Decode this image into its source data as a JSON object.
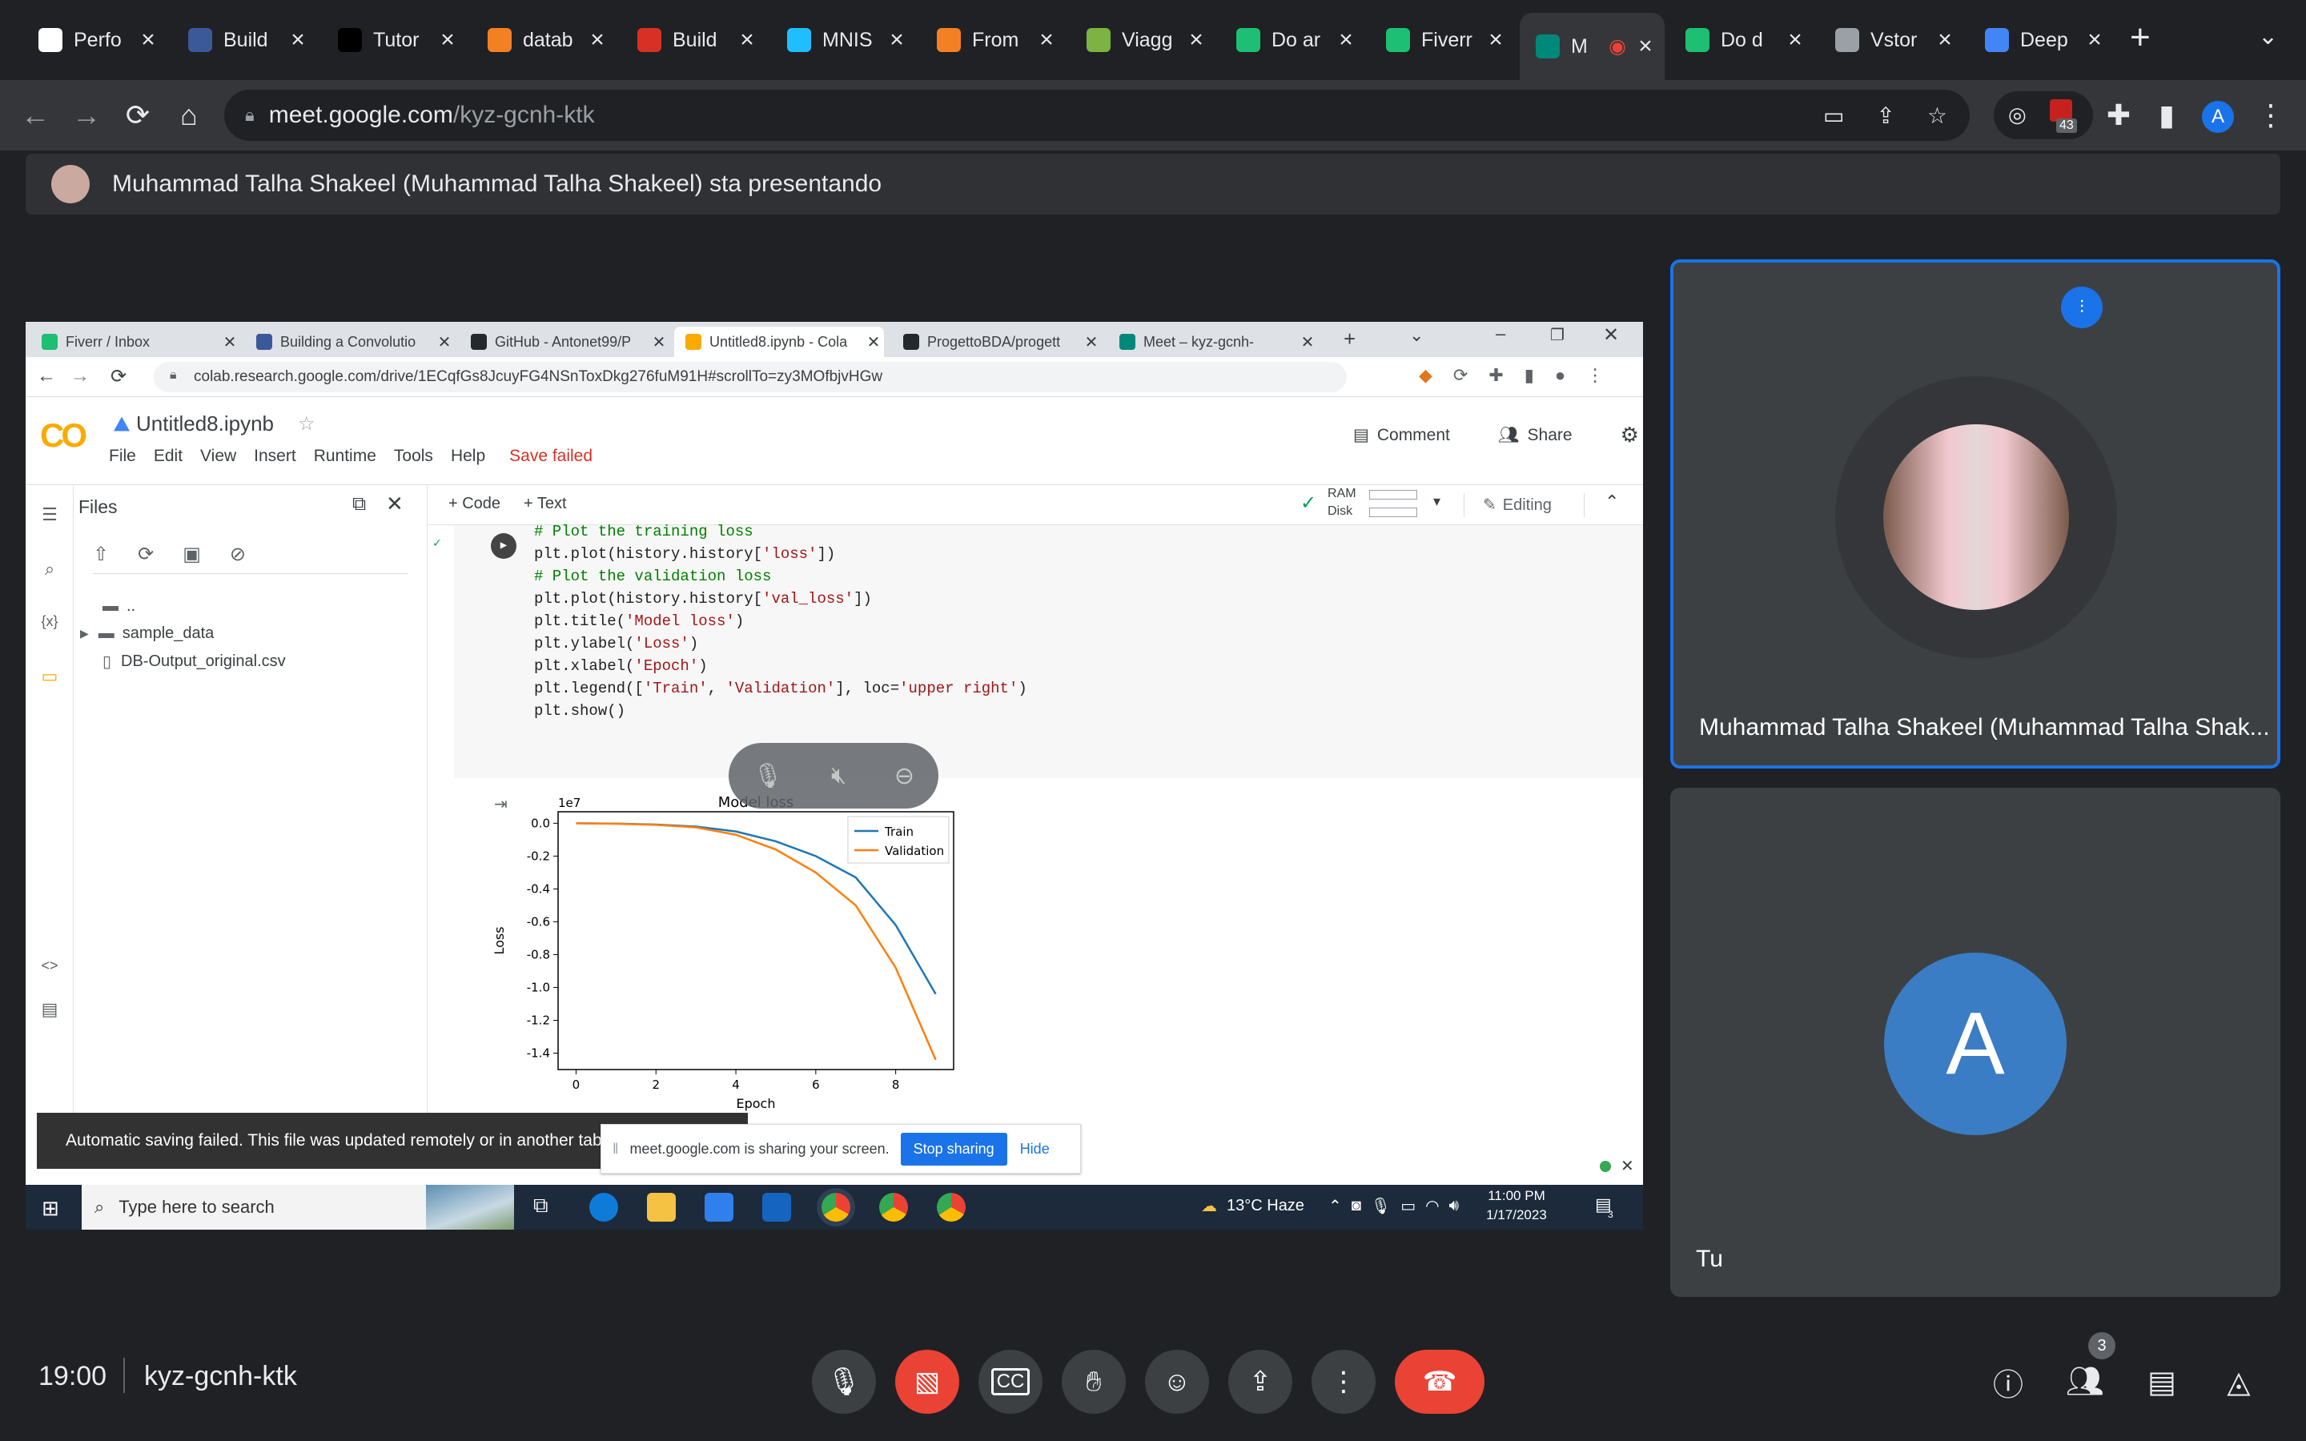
{
  "browser": {
    "tabs": [
      {
        "label": "Perfo",
        "icon": "chart-favicon",
        "color": "#ffffff"
      },
      {
        "label": "Build",
        "icon": "tds-favicon",
        "color": "#3b5998"
      },
      {
        "label": "Tutor",
        "icon": "medium-favicon",
        "color": "#000000"
      },
      {
        "label": "datab",
        "icon": "stackoverflow-favicon",
        "color": "#f48024"
      },
      {
        "label": "Build",
        "icon": "k-favicon",
        "color": "#d93025"
      },
      {
        "label": "MNIS",
        "icon": "kaggle-favicon",
        "color": "#20beff"
      },
      {
        "label": "From",
        "icon": "stackoverflow-favicon",
        "color": "#f48024"
      },
      {
        "label": "Viagg",
        "icon": "peace-favicon",
        "color": "#7cb342"
      },
      {
        "label": "Do ar",
        "icon": "fiverr-favicon",
        "color": "#1dbf73"
      },
      {
        "label": "Fiverr",
        "icon": "fiverr-favicon",
        "color": "#1dbf73"
      },
      {
        "label": "M",
        "icon": "meet-favicon",
        "color": "#00897b"
      },
      {
        "label": "Do d",
        "icon": "fiverr-favicon",
        "color": "#1dbf73"
      },
      {
        "label": "Vstor",
        "icon": "globe-favicon",
        "color": "#9aa0a6"
      },
      {
        "label": "Deep",
        "icon": "shield-favicon",
        "color": "#4285f4"
      }
    ],
    "new_tab": "+",
    "url_host": "meet.google.com",
    "url_path": "/kyz-gcnh-ktk",
    "ext_badge": "43",
    "profile_letter": "A"
  },
  "presenter_banner": "Muhammad Talha Shakeel (Muhammad Talha Shakeel) sta presentando",
  "shared": {
    "tabs": [
      {
        "label": "Fiverr / Inbox",
        "color": "#1dbf73"
      },
      {
        "label": "Building a Convolutio",
        "color": "#3b5998"
      },
      {
        "label": "GitHub - Antonet99/P",
        "color": "#24292e"
      },
      {
        "label": "Untitled8.ipynb - Cola",
        "color": "#f9ab00"
      },
      {
        "label": "ProgettoBDA/progett",
        "color": "#24292e"
      },
      {
        "label": "Meet – kyz-gcnh-",
        "color": "#00897b"
      }
    ],
    "url": "colab.research.google.com/drive/1ECqfGs8JcuyFG4NSnToxDkg276fuM91H#scrollTo=zy3MOfbjvHGw",
    "notebook_title": "Untitled8.ipynb",
    "menu": [
      "File",
      "Edit",
      "View",
      "Insert",
      "Runtime",
      "Tools",
      "Help"
    ],
    "save_status": "Save failed",
    "comment": "Comment",
    "share": "Share",
    "add_code": "+ Code",
    "add_text": "+ Text",
    "ram": "RAM",
    "disk": "Disk",
    "editing": "Editing",
    "files_title": "Files",
    "file_tree": [
      "..",
      "sample_data",
      "DB-Output_original.csv"
    ],
    "code_lines": [
      {
        "text": "# Plot the training loss",
        "kind": "com"
      },
      {
        "text": "plt.plot(history.history['loss'])",
        "kind": "code"
      },
      {
        "text": "# Plot the validation loss",
        "kind": "com"
      },
      {
        "text": "plt.plot(history.history['val_loss'])",
        "kind": "code"
      },
      {
        "text": "plt.title('Model loss')",
        "kind": "code"
      },
      {
        "text": "plt.ylabel('Loss')",
        "kind": "code"
      },
      {
        "text": "plt.xlabel('Epoch')",
        "kind": "code"
      },
      {
        "text": "plt.legend(['Train', 'Validation'], loc='upper right')",
        "kind": "code"
      },
      {
        "text": "plt.show()",
        "kind": "code"
      }
    ],
    "snackbar": "Automatic saving failed. This file was updated remotely or in another tab",
    "share_notice": "meet.google.com is sharing your screen.",
    "stop_sharing": "Stop sharing",
    "hide": "Hide",
    "taskbar_search": "Type here to search",
    "weather": "13°C  Haze",
    "time": "11:00 PM",
    "date": "1/17/2023",
    "notif_count": "3"
  },
  "chart_data": {
    "type": "line",
    "title": "Model loss",
    "xlabel": "Epoch",
    "ylabel": "Loss",
    "offset_label": "1e7",
    "x": [
      0,
      1,
      2,
      3,
      4,
      5,
      6,
      7,
      8,
      9
    ],
    "xlim": [
      -0.45,
      9.45
    ],
    "ylim": [
      -1.5,
      0.07
    ],
    "xticks": [
      "0",
      "2",
      "4",
      "6",
      "8"
    ],
    "yticks": [
      "0.0",
      "-0.2",
      "-0.4",
      "-0.6",
      "-0.8",
      "-1.0",
      "-1.2",
      "-1.4"
    ],
    "legend_position": "upper right",
    "series": [
      {
        "name": "Train",
        "color": "#1f77b4",
        "values": [
          0,
          -0.002,
          -0.008,
          -0.02,
          -0.05,
          -0.11,
          -0.2,
          -0.33,
          -0.62,
          -1.04
        ]
      },
      {
        "name": "Validation",
        "color": "#ff7f0e",
        "values": [
          0,
          -0.003,
          -0.01,
          -0.025,
          -0.07,
          -0.16,
          -0.3,
          -0.5,
          -0.88,
          -1.44
        ]
      }
    ]
  },
  "tiles": {
    "speaker_name": "Muhammad Talha Shakeel (Muhammad Talha Shak...",
    "self_name": "Tu",
    "self_initial": "A"
  },
  "meeting": {
    "time": "19:00",
    "code": "kyz-gcnh-ktk",
    "people_count": "3"
  }
}
